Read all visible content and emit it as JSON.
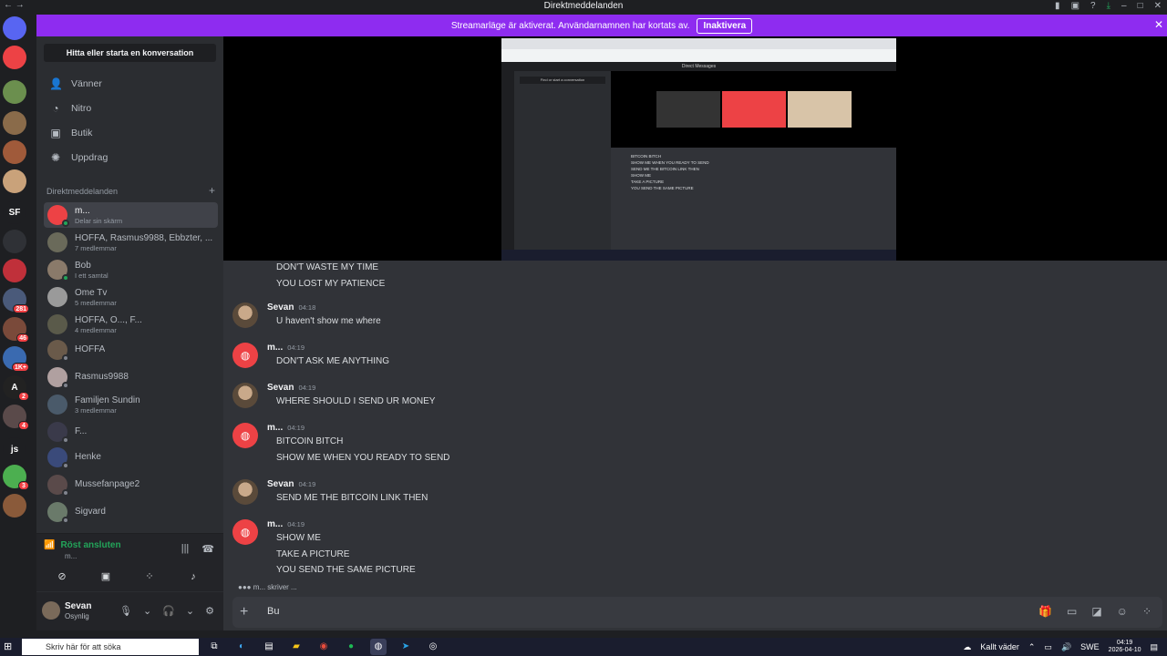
{
  "titlebar": {
    "title": "Direktmeddelanden",
    "back": "←",
    "forward": "→"
  },
  "banner": {
    "text": "Streamarläge är aktiverat. Användarnamnen har kortats av.",
    "button": "Inaktivera",
    "close": "✕",
    "color": "#8e2cf0"
  },
  "rail": {
    "servers": [
      {
        "label": "",
        "color": "#5865f2",
        "badge": ""
      },
      {
        "label": "",
        "color": "#ed4245",
        "badge": ""
      },
      {
        "label": "",
        "color": "#6b8f4e",
        "badge": ""
      },
      {
        "label": "",
        "color": "#8a6b4a",
        "badge": ""
      },
      {
        "label": "",
        "color": "#a05a3a",
        "badge": ""
      },
      {
        "label": "",
        "color": "#c9a27a",
        "badge": ""
      },
      {
        "label": "SF",
        "color": "#1e1f22",
        "badge": ""
      },
      {
        "label": "",
        "color": "#2f3136",
        "badge": ""
      },
      {
        "label": "",
        "color": "#c0303a",
        "badge": ""
      },
      {
        "label": "",
        "color": "#4a5a7a",
        "badge": "281"
      },
      {
        "label": "",
        "color": "#7a4a3a",
        "badge": "46"
      },
      {
        "label": "",
        "color": "#3a6ab0",
        "badge": "1K+"
      },
      {
        "label": "A",
        "color": "#222",
        "badge": "2"
      },
      {
        "label": "",
        "color": "#5a4a4a",
        "badge": "4"
      },
      {
        "label": "js",
        "color": "#1e1f22",
        "badge": ""
      },
      {
        "label": "",
        "color": "#4caf50",
        "badge": "3"
      },
      {
        "label": "",
        "color": "#8a5a3a",
        "badge": ""
      }
    ]
  },
  "sidebar": {
    "search": "Hitta eller starta en konversation",
    "nav": [
      {
        "label": "Vänner",
        "icon": "👤"
      },
      {
        "label": "Nitro",
        "icon": "◔"
      },
      {
        "label": "Butik",
        "icon": "▣"
      },
      {
        "label": "Uppdrag",
        "icon": "✺"
      }
    ],
    "dm_header": "Direktmeddelanden",
    "dm_add": "+",
    "dms": [
      {
        "name": "m...",
        "sub": "Delar sin skärm",
        "color": "#ed4245",
        "status": "#23a55a",
        "active": true
      },
      {
        "name": "HOFFA, Rasmus9988, Ebbzter, ...",
        "sub": "7 medlemmar",
        "color": "#6a6a5a",
        "status": "",
        "active": false
      },
      {
        "name": "Bob",
        "sub": "I ett samtal",
        "color": "#8a7a6a",
        "status": "#23a55a",
        "active": false
      },
      {
        "name": "Ome Tv",
        "sub": "5 medlemmar",
        "color": "#9a9a9a",
        "status": "",
        "active": false
      },
      {
        "name": "HOFFA, O..., F...",
        "sub": "4 medlemmar",
        "color": "#5a5a4a",
        "status": "",
        "active": false
      },
      {
        "name": "HOFFA",
        "sub": "",
        "color": "#6a5a4a",
        "status": "#80848e",
        "active": false
      },
      {
        "name": "Rasmus9988",
        "sub": "",
        "color": "#b0a0a0",
        "status": "#80848e",
        "active": false
      },
      {
        "name": "Familjen Sundin",
        "sub": "3 medlemmar",
        "color": "#4a5a6a",
        "status": "",
        "active": false
      },
      {
        "name": "F...",
        "sub": "",
        "color": "#3a3a4a",
        "status": "#80848e",
        "active": false
      },
      {
        "name": "Henke",
        "sub": "",
        "color": "#3a4a7a",
        "status": "#80848e",
        "active": false
      },
      {
        "name": "Mussefanpage2",
        "sub": "",
        "color": "#5a4a4a",
        "status": "#80848e",
        "active": false
      },
      {
        "name": "Sigvard",
        "sub": "",
        "color": "#6a7a6a",
        "status": "#80848e",
        "active": false
      }
    ]
  },
  "voice": {
    "title": "Röst ansluten",
    "sub": "m..."
  },
  "user": {
    "name": "Sevan",
    "status": "Osynlig"
  },
  "messages": [
    {
      "author": "",
      "time": "",
      "avatar": "",
      "lines": [
        "DON'T WASTE MY TIME",
        "YOU LOST MY PATIENCE"
      ]
    },
    {
      "author": "Sevan",
      "time": "04:18",
      "avatar": "sevan",
      "lines": [
        "U haven't show me where"
      ]
    },
    {
      "author": "m...",
      "time": "04:19",
      "avatar": "discord",
      "lines": [
        "DON'T ASK ME ANYTHING"
      ]
    },
    {
      "author": "Sevan",
      "time": "04:19",
      "avatar": "sevan",
      "lines": [
        "WHERE SHOULD I SEND UR MONEY"
      ]
    },
    {
      "author": "m...",
      "time": "04:19",
      "avatar": "discord",
      "lines": [
        "BITCOIN BITCH",
        "SHOW ME WHEN YOU READY TO SEND"
      ]
    },
    {
      "author": "Sevan",
      "time": "04:19",
      "avatar": "sevan",
      "lines": [
        "SEND ME THE BITCOIN LINK THEN"
      ]
    },
    {
      "author": "m...",
      "time": "04:19",
      "avatar": "discord",
      "lines": [
        "SHOW ME",
        "TAKE A PICTURE",
        "YOU SEND THE SAME PICTURE"
      ]
    }
  ],
  "typing": "m... skriver ...",
  "composer": {
    "value": "Bu",
    "plus": "+"
  },
  "taskbar": {
    "search_placeholder": "Skriv här för att söka",
    "weather": "Kallt väder",
    "lang": "SWE",
    "time": "04:19",
    "date": "2026-04-10"
  },
  "stream": {
    "inner_title": "Direct Messages",
    "inner_search": "Find or start a conversation",
    "inner_msgs": [
      "BITCOIN BITCH",
      "SHOW ME WHEN YOU READY TO SEND",
      "SEND ME THE BITCOIN LINK THEN",
      "SHOW ME",
      "TAKE A PICTURE",
      "YOU SEND THE SAME PICTURE"
    ]
  }
}
